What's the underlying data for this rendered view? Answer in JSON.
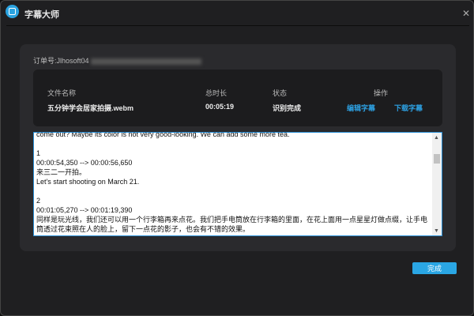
{
  "window": {
    "title": "字幕大师",
    "close_icon": "close-icon",
    "logo_icon": "subtitle-logo-icon"
  },
  "order": {
    "label": "订单号:Jlhosoft04"
  },
  "table": {
    "headers": [
      "文件名称",
      "总时长",
      "状态",
      "操作"
    ],
    "row": {
      "filename": "五分钟学会居家拍摄.webm",
      "duration": "00:05:19",
      "status": "识别完成",
      "edit": "编辑字幕",
      "download": "下载字幕"
    }
  },
  "subtitles": {
    "text": "come out? Maybe its color is not very good-looking. We can add some more tea.\n\n1\n00:00:54,350 --> 00:00:56,650\n来三二一开拍。\nLet's start shooting on March 21.\n\n2\n00:01:05,270 --> 00:01:19,390\n同样是玩光线，我们还可以用一个行李箱再来点花。我们把手电筒放在行李箱的里面，在花上面用一点星星灯做点缀，让手电筒透过花束照在人的脸上，留下一点花的影子，也会有不错的效果。\nWe can also use a suitcase and some flowers to play with the light. We put the flashlight in the suitcase and decorate the flowers with a little star light."
  },
  "footer": {
    "done": "完成"
  },
  "colors": {
    "accent": "#2aa6e4",
    "background": "#1f1f21",
    "panel": "#2a2a2d"
  }
}
